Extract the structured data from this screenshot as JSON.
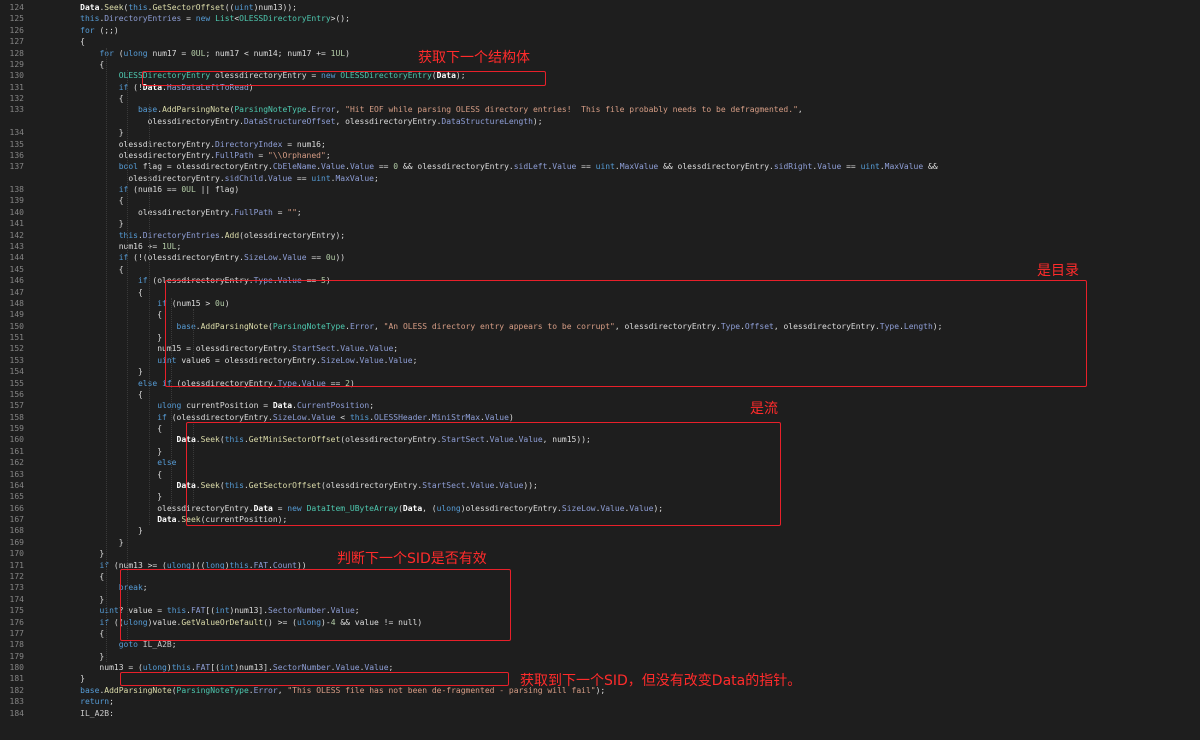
{
  "line_numbers": [
    "124",
    "125",
    "126",
    "127",
    "128",
    "129",
    "130",
    "131",
    "132",
    "133",
    "",
    "134",
    "135",
    "136",
    "137",
    "",
    "138",
    "139",
    "140",
    "141",
    "142",
    "143",
    "144",
    "145",
    "146",
    "147",
    "148",
    "149",
    "150",
    "151",
    "152",
    "153",
    "154",
    "155",
    "156",
    "157",
    "158",
    "159",
    "160",
    "161",
    "162",
    "163",
    "164",
    "165",
    "166",
    "167",
    "168",
    "169",
    "170",
    "171",
    "172",
    "173",
    "174",
    "175",
    "176",
    "177",
    "178",
    "179",
    "180",
    "181",
    "182",
    "183",
    "184"
  ],
  "code_lines": [
    "          Data.Seek(this.GetSectorOffset((uint)num13));",
    "          this.DirectoryEntries = new List<OLESSDirectoryEntry>();",
    "          for (;;)",
    "          {",
    "              for (ulong num17 = 0UL; num17 < num14; num17 += 1UL)",
    "              {",
    "                  OLESSDirectoryEntry olessdirectoryEntry = new OLESSDirectoryEntry(Data);",
    "                  if (!Data.HasDataLeftToRead)",
    "                  {",
    "                      base.AddParsingNote(ParsingNoteType.Error, \"Hit EOF while parsing OLESS directory entries!  This file probably needs to be defragmented.\",",
    "                        olessdirectoryEntry.DataStructureOffset, olessdirectoryEntry.DataStructureLength);",
    "                  }",
    "                  olessdirectoryEntry.DirectoryIndex = num16;",
    "                  olessdirectoryEntry.FullPath = \"\\\\Orphaned\";",
    "                  bool flag = olessdirectoryEntry.CbEleName.Value.Value == 0 && olessdirectoryEntry.sidLeft.Value == uint.MaxValue && olessdirectoryEntry.sidRight.Value == uint.MaxValue &&",
    "                    olessdirectoryEntry.sidChild.Value == uint.MaxValue;",
    "                  if (num16 == 0UL || flag)",
    "                  {",
    "                      olessdirectoryEntry.FullPath = \"\";",
    "                  }",
    "                  this.DirectoryEntries.Add(olessdirectoryEntry);",
    "                  num16 += 1UL;",
    "                  if (!(olessdirectoryEntry.SizeLow.Value == 0u))",
    "                  {",
    "                      if (olessdirectoryEntry.Type.Value == 5)",
    "                      {",
    "                          if (num15 > 0u)",
    "                          {",
    "                              base.AddParsingNote(ParsingNoteType.Error, \"An OLESS directory entry appears to be corrupt\", olessdirectoryEntry.Type.Offset, olessdirectoryEntry.Type.Length);",
    "                          }",
    "                          num15 = olessdirectoryEntry.StartSect.Value.Value;",
    "                          uint value6 = olessdirectoryEntry.SizeLow.Value.Value;",
    "                      }",
    "                      else if (olessdirectoryEntry.Type.Value == 2)",
    "                      {",
    "                          ulong currentPosition = Data.CurrentPosition;",
    "                          if (olessdirectoryEntry.SizeLow.Value < this.OLESSHeader.MiniStrMax.Value)",
    "                          {",
    "                              Data.Seek(this.GetMiniSectorOffset(olessdirectoryEntry.StartSect.Value.Value, num15));",
    "                          }",
    "                          else",
    "                          {",
    "                              Data.Seek(this.GetSectorOffset(olessdirectoryEntry.StartSect.Value.Value));",
    "                          }",
    "                          olessdirectoryEntry.Data = new DataItem_UByteArray(Data, (ulong)olessdirectoryEntry.SizeLow.Value.Value);",
    "                          Data.Seek(currentPosition);",
    "                      }",
    "                  }",
    "              }",
    "              if (num13 >= (ulong)((long)this.FAT.Count))",
    "              {",
    "                  break;",
    "              }",
    "              uint? value = this.FAT[(int)num13].SectorNumber.Value;",
    "              if ((ulong)value.GetValueOrDefault() >= (ulong)-4 && value != null)",
    "              {",
    "                  goto IL_A2B;",
    "              }",
    "              num13 = (ulong)this.FAT[(int)num13].SectorNumber.Value.Value;",
    "          }",
    "          base.AddParsingNote(ParsingNoteType.Error, \"This OLESS file has not been de-fragmented - parsing will fail\");",
    "          return;",
    "          IL_A2B:"
  ],
  "annotations": {
    "get_next_struct": "获取下一个结构体",
    "is_directory": "是目录",
    "is_stream": "是流",
    "check_next_sid": "判断下一个SID是否有效",
    "got_next_sid": "获取到下一个SID，但没有改变Data的指针。"
  },
  "colors": {
    "background": "#1e1e1e",
    "annotation_red": "#ff2b2b",
    "keyword": "#569cd6",
    "type": "#4ec9b0",
    "method": "#dcdcaa",
    "property": "#8f9fd7",
    "string": "#d69d85",
    "plain": "#dcdcdc",
    "line_number": "#858585"
  }
}
